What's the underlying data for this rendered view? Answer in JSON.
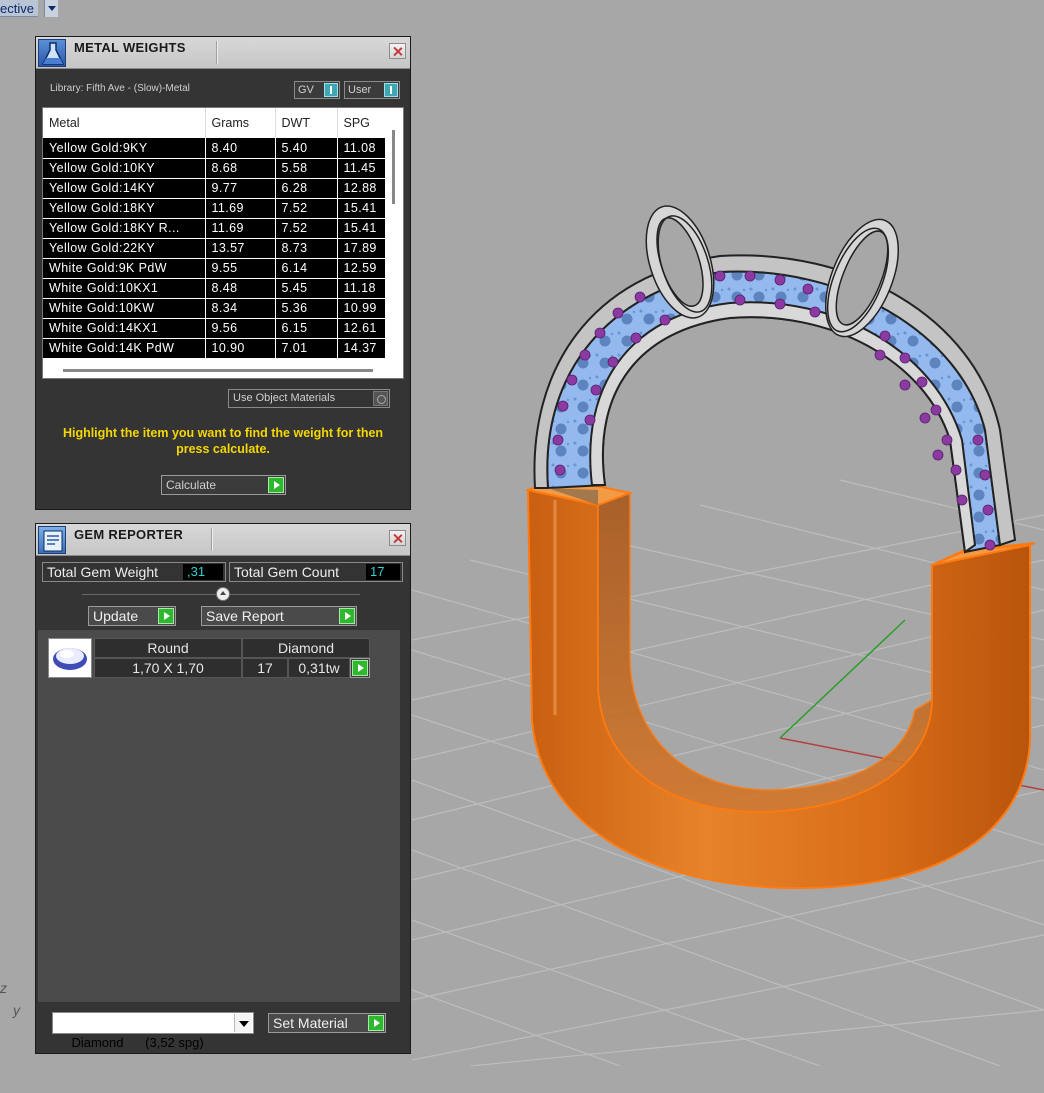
{
  "viewport": {
    "label": "ective",
    "axis_z": "z",
    "axis_y": "y"
  },
  "metal_weights": {
    "title": "METAL WEIGHTS",
    "library": "Library: Fifth Ave - (Slow)-Metal",
    "toggle_gv": "GV",
    "toggle_user": "User",
    "columns": [
      "Metal",
      "Grams",
      "DWT",
      "SPG"
    ],
    "rows": [
      [
        "Yellow Gold:9KY",
        "8.40",
        "5.40",
        "11.08"
      ],
      [
        "Yellow Gold:10KY",
        "8.68",
        "5.58",
        "11.45"
      ],
      [
        "Yellow Gold:14KY",
        "9.77",
        "6.28",
        "12.88"
      ],
      [
        "Yellow Gold:18KY",
        "11.69",
        "7.52",
        "15.41"
      ],
      [
        "Yellow Gold:18KY R...",
        "11.69",
        "7.52",
        "15.41"
      ],
      [
        "Yellow Gold:22KY",
        "13.57",
        "8.73",
        "17.89"
      ],
      [
        "White Gold:9K PdW",
        "9.55",
        "6.14",
        "12.59"
      ],
      [
        "White Gold:10KX1",
        "8.48",
        "5.45",
        "11.18"
      ],
      [
        "White Gold:10KW",
        "8.34",
        "5.36",
        "10.99"
      ],
      [
        "White Gold:14KX1",
        "9.56",
        "6.15",
        "12.61"
      ],
      [
        "White Gold:14K PdW",
        "10.90",
        "7.01",
        "14.37"
      ]
    ],
    "use_object_materials": "Use Object Materials",
    "hint": "Highlight the item you want to find the weight for then press calculate.",
    "calculate_label": "Calculate"
  },
  "gem_reporter": {
    "title": "GEM REPORTER",
    "total_weight_label": "Total Gem Weight",
    "total_weight_value": ",31",
    "total_count_label": "Total Gem Count",
    "total_count_value": "17",
    "update_label": "Update",
    "save_report_label": "Save Report",
    "gem": {
      "shape": "Round",
      "material": "Diamond",
      "size": "1,70 X 1,70",
      "count": "17",
      "weight": "0,31tw"
    },
    "material_select": "Diamond      (3,52 spg)",
    "set_material_label": "Set Material"
  },
  "colors": {
    "hint_yellow": "#f4d600",
    "accent_green": "#2fb82f",
    "accent_teal": "#3fa7b4",
    "ring_orange": "#e07a22",
    "gem_blue": "#8cb6ee",
    "stone_purple": "#8a3aa0"
  }
}
